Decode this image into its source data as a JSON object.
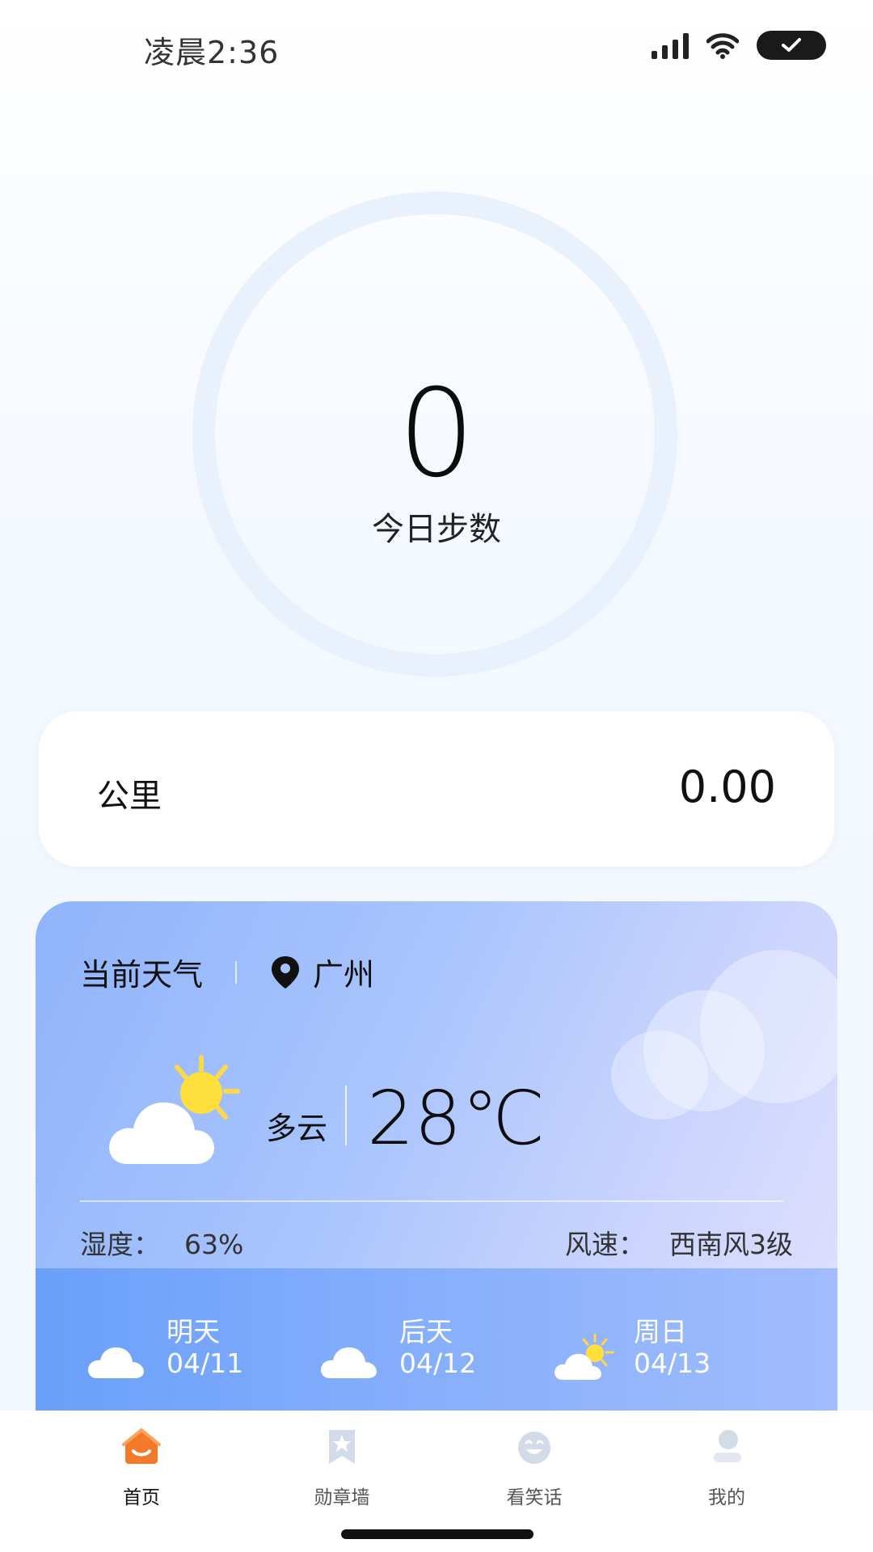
{
  "status_bar": {
    "time": "凌晨2:36"
  },
  "steps": {
    "count": "0",
    "label": "今日步数"
  },
  "distance": {
    "label": "公里",
    "value": "0.00"
  },
  "weather": {
    "title": "当前天气",
    "city": "广州",
    "condition": "多云",
    "temperature": "28℃",
    "humidity_label": "湿度：",
    "humidity_value": "63%",
    "wind_label": "风速：",
    "wind_value": "西南风3级",
    "forecast": [
      {
        "day": "明天",
        "date": "04/11",
        "icon": "cloud-icon"
      },
      {
        "day": "后天",
        "date": "04/12",
        "icon": "cloud-icon"
      },
      {
        "day": "周日",
        "date": "04/13",
        "icon": "partly-cloudy-icon"
      }
    ]
  },
  "tabs": [
    {
      "label": "首页",
      "icon": "home-icon",
      "active": true
    },
    {
      "label": "勋章墙",
      "icon": "badge-icon",
      "active": false
    },
    {
      "label": "看笑话",
      "icon": "laugh-icon",
      "active": false
    },
    {
      "label": "我的",
      "icon": "profile-icon",
      "active": false
    }
  ],
  "colors": {
    "accent": "#f4792a",
    "ring": "#e9f1fd",
    "weather_card": "#8fb4fb"
  }
}
